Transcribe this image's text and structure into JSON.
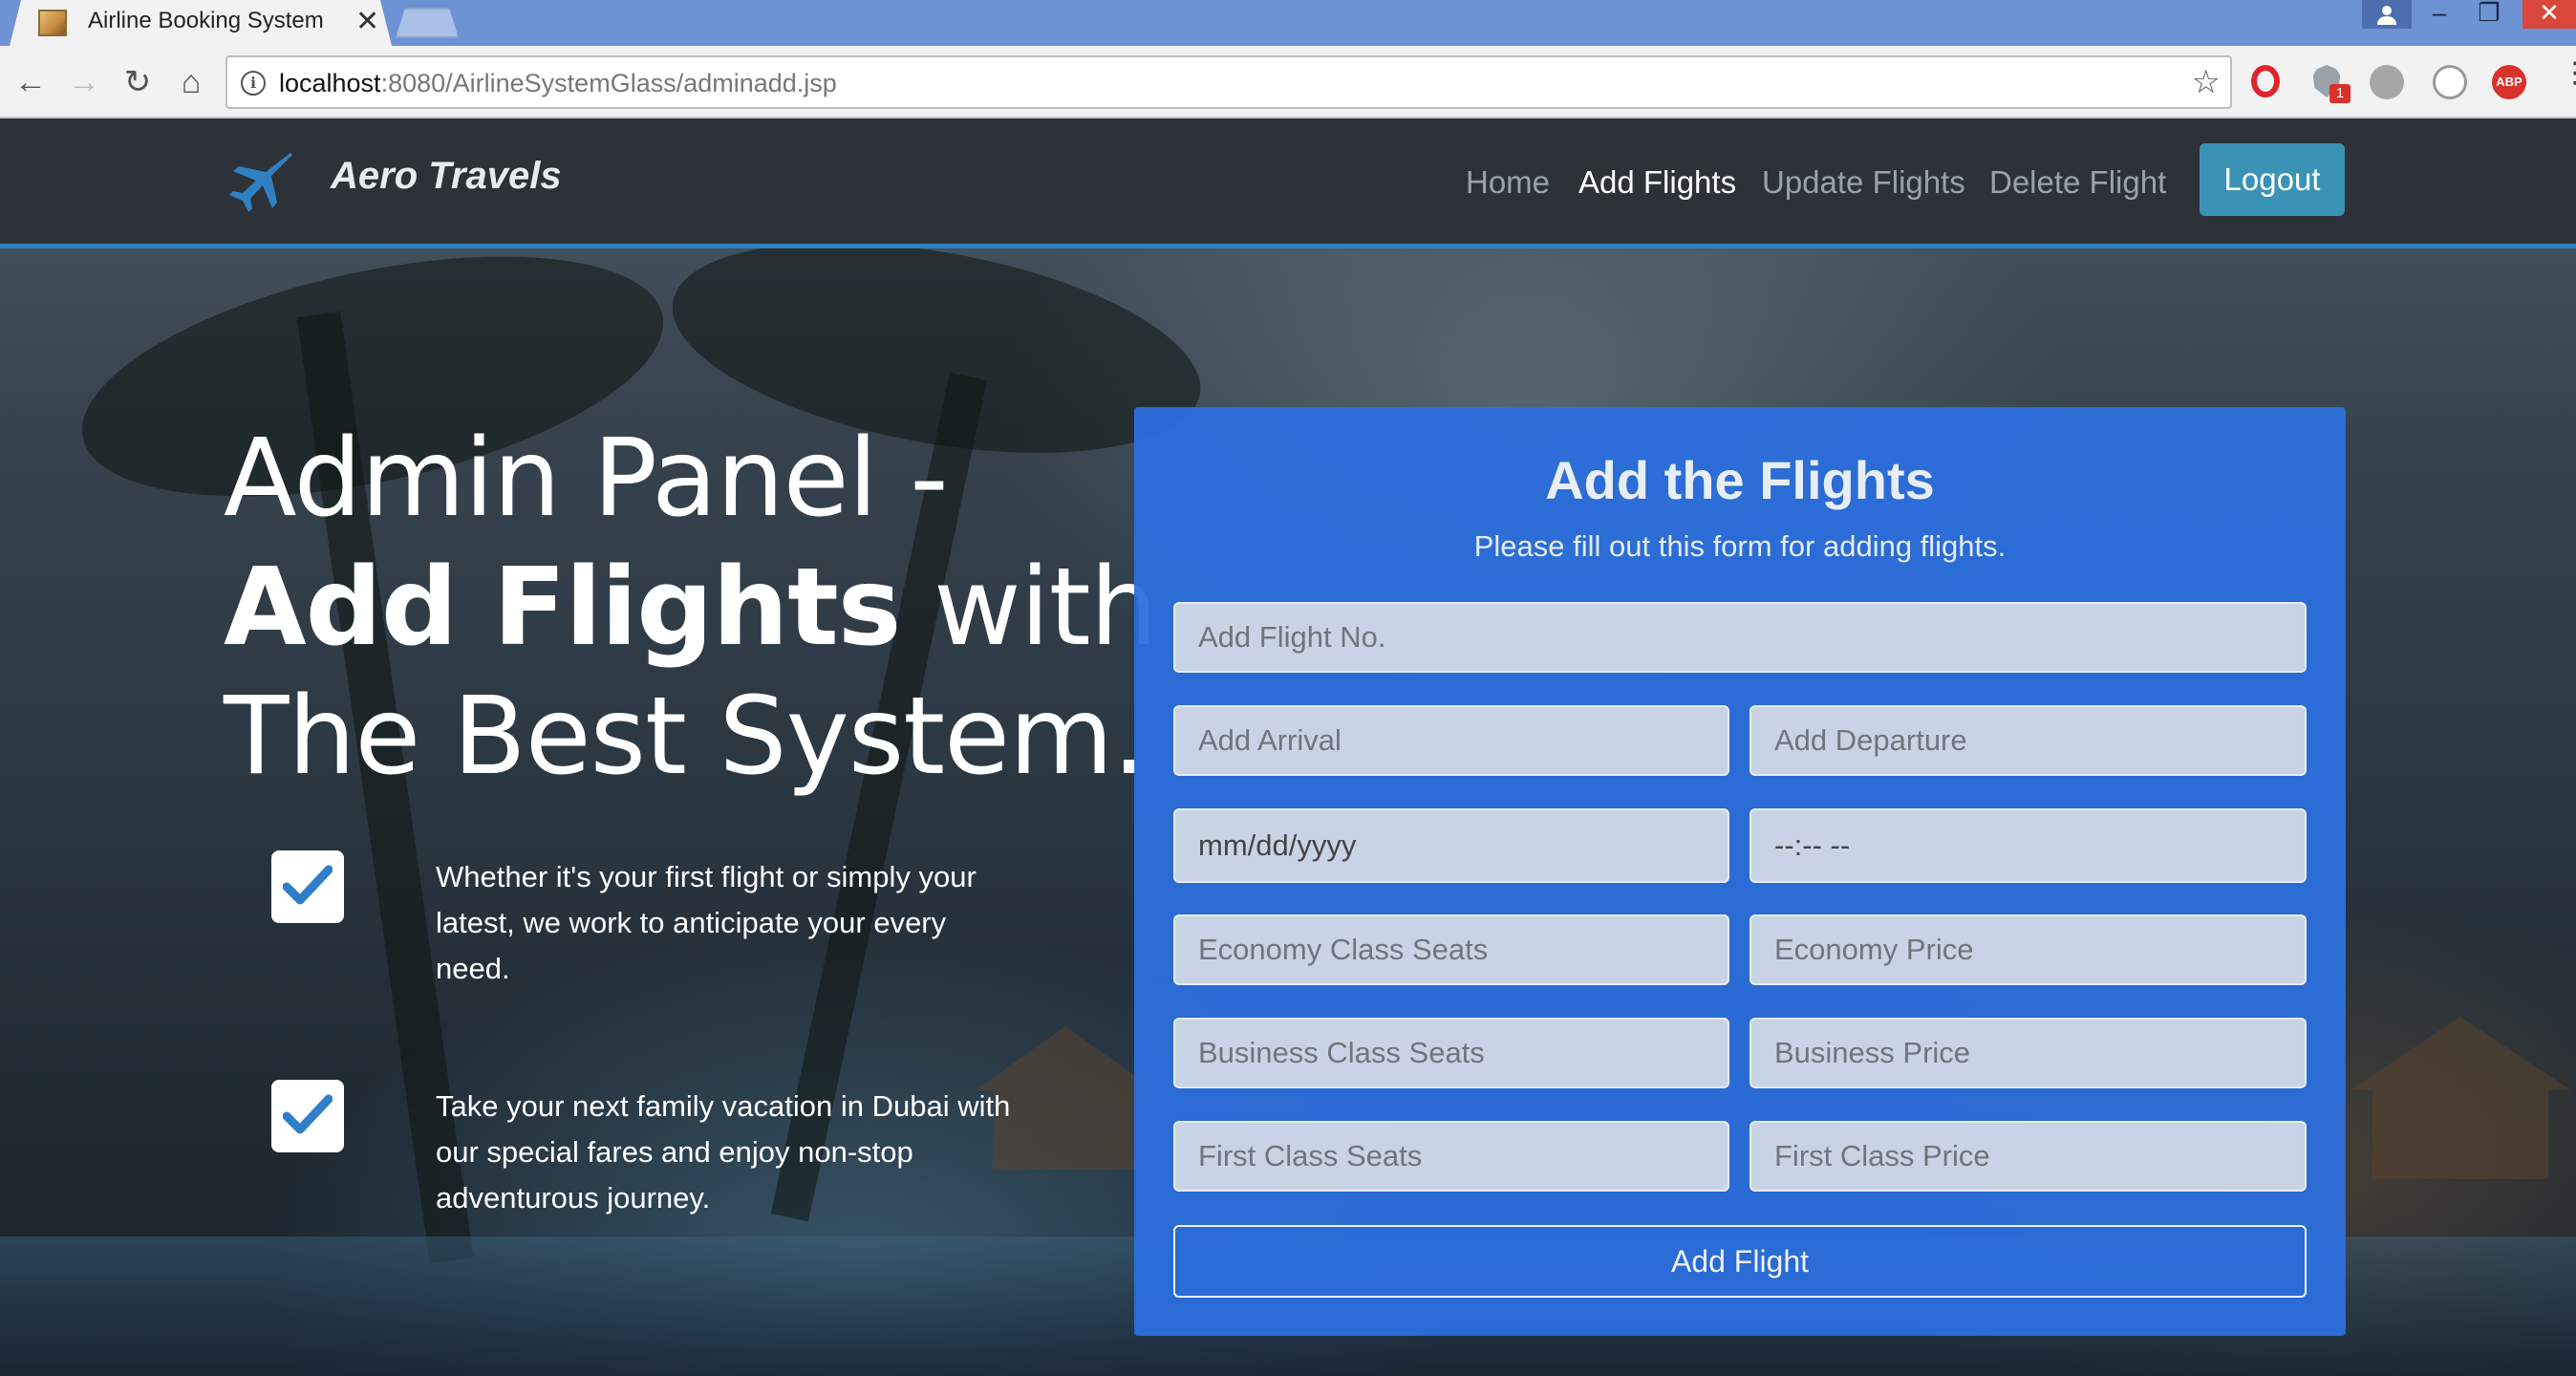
{
  "browser": {
    "tab_title": "Airline Booking System",
    "tab_close": "✕",
    "url_host": "localhost",
    "url_path": ":8080/AirlineSystemGlass/adminadd.jsp",
    "extension_badge": "1",
    "abp_label": "ABP"
  },
  "navbar": {
    "brand": "Aero Travels",
    "links": [
      "Home",
      "Add Flights",
      "Update Flights",
      "Delete Flight"
    ],
    "active_link": "Add Flights",
    "logout_label": "Logout"
  },
  "hero": {
    "line1": "Admin Panel -",
    "line2_bold": "Add Flights",
    "line2_rest": " with",
    "line3": "The Best System."
  },
  "features": [
    "Whether it's your first flight or simply your latest, we work to anticipate your every need.",
    "Take your next family vacation in Dubai with our special fares and enjoy non-stop adventurous journey."
  ],
  "form": {
    "title": "Add the Flights",
    "subtitle": "Please fill out this form for adding flights.",
    "flight_no_placeholder": "Add Flight No.",
    "arrival_placeholder": "Add Arrival",
    "departure_placeholder": "Add Departure",
    "date_placeholder": "mm/dd/yyyy",
    "time_placeholder": "--:-- --",
    "economy_seats_placeholder": "Economy Class Seats",
    "economy_price_placeholder": "Economy Price",
    "business_seats_placeholder": "Business Class Seats",
    "business_price_placeholder": "Business Price",
    "first_seats_placeholder": "First Class Seats",
    "first_price_placeholder": "First Class Price",
    "submit_label": "Add Flight"
  },
  "colors": {
    "navbar_bg": "#2c3238",
    "navbar_accent": "#2e80c4",
    "logout_bg": "#3a93b4",
    "card_bg": "#2b6ede",
    "check_color": "#2f7fc8"
  }
}
